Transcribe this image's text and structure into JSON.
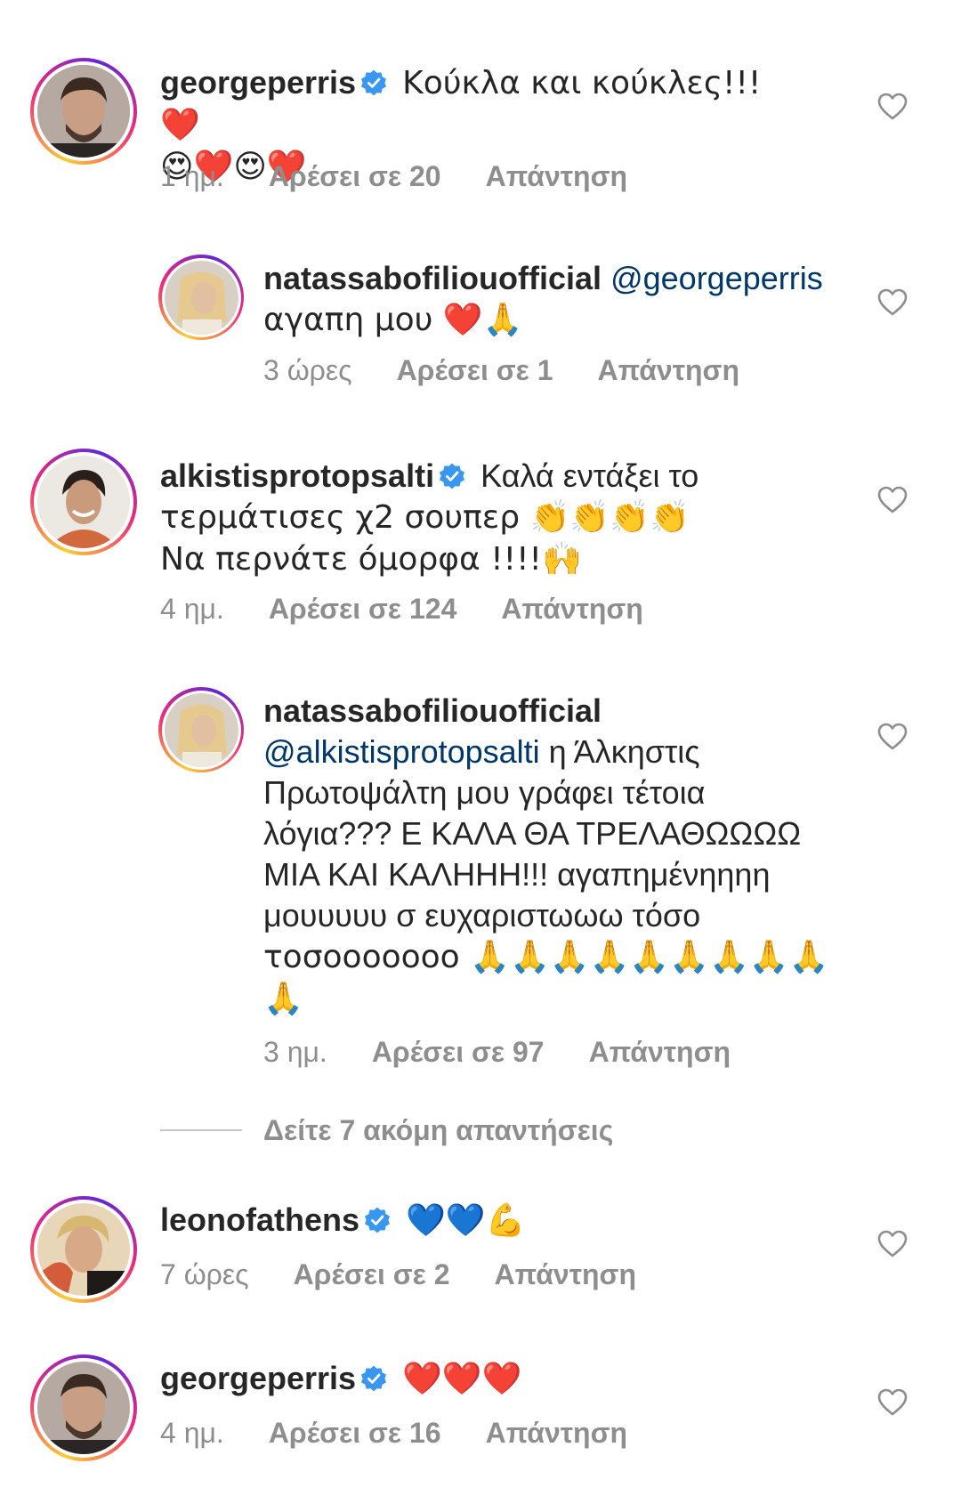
{
  "comments": [
    {
      "username": "georgeperris",
      "verified": true,
      "text": "Κούκλα και κούκλες!!! ❤️",
      "text2": "😍❤️😍❤️",
      "time": "1 ημ.",
      "likes": "Αρέσει σε 20",
      "reply": "Απάντηση"
    },
    {
      "username": "natassabofiliouofficial",
      "mention": "@georgeperris",
      "text": "αγαπη μου ❤️🙏",
      "time": "3 ώρες",
      "likes": "Αρέσει σε 1",
      "reply": "Απάντηση"
    },
    {
      "username": "alkistisprotopsalti",
      "verified": true,
      "text": "Καλά εντάξει το",
      "text2": "τερμάτισες χ2 σουπερ 👏👏👏👏",
      "text3": "Να περνάτε όμορφα !!!!🙌",
      "time": "4 ημ.",
      "likes": "Αρέσει σε 124",
      "reply": "Απάντηση"
    },
    {
      "username": "natassabofiliouofficial",
      "mention": "@alkistisprotopsalti",
      "text": " η Άλκηστις",
      "lines": [
        "Πρωτοψάλτη μου γράφει τέτοια",
        "λόγια??? Ε ΚΑΛΑ ΘΑ ΤΡΕΛΑΘΩΩΩΩ",
        "ΜΙΑ ΚΑΙ ΚΑΛΗΗΗ!!! αγαπημένηηηη",
        "μουυυυυ σ ευχαριστωωω τόσο",
        "τοσοοοοοοο 🙏🙏🙏🙏🙏🙏🙏🙏🙏",
        "🙏"
      ],
      "time": "3 ημ.",
      "likes": "Αρέσει σε 97",
      "reply": "Απάντηση"
    },
    {
      "username": "leonofathens",
      "verified": true,
      "text": "💙💙💪",
      "time": "7 ώρες",
      "likes": "Αρέσει σε 2",
      "reply": "Απάντηση"
    },
    {
      "username": "georgeperris",
      "verified": true,
      "text": "❤️❤️❤️",
      "time": "4 ημ.",
      "likes": "Αρέσει σε 16",
      "reply": "Απάντηση"
    }
  ],
  "view_more": "Δείτε 7 ακόμη απαντήσεις",
  "icons": {
    "verified": "verified-badge-icon",
    "heart": "heart-outline-icon"
  },
  "colors": {
    "verified": "#3897f0",
    "mention": "#00376b",
    "meta": "#8e8e8e"
  }
}
